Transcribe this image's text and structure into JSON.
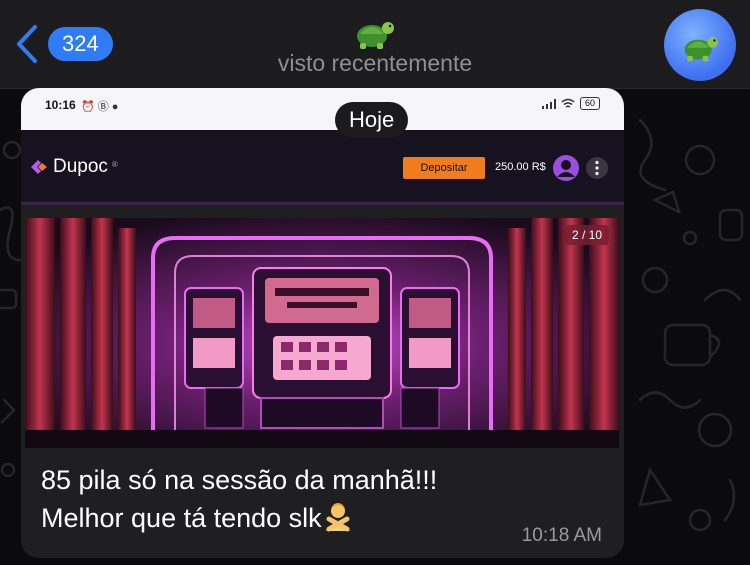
{
  "header": {
    "back_count": "324",
    "title_icon": "turtle-emoji",
    "subtitle": "visto recentemente",
    "avatar_icon": "turtle-emoji"
  },
  "message": {
    "date_label": "Hoje",
    "screenshot": {
      "status_time": "10:16",
      "battery": "60",
      "brand": "Dupoc",
      "brand_mark": "®",
      "deposit_label": "Depositar",
      "balance": "250.00 R$",
      "banner_counter": "2 / 10"
    },
    "line1": "85 pila só na sessão da manhã!!!",
    "line2": "Melhor que tá tendo slk",
    "emoji": "person-gesturing-no",
    "time": "10:18 AM"
  },
  "colors": {
    "accent": "#2f7cf6",
    "deposit": "#f07d1d",
    "bubble": "#1f1f21"
  }
}
